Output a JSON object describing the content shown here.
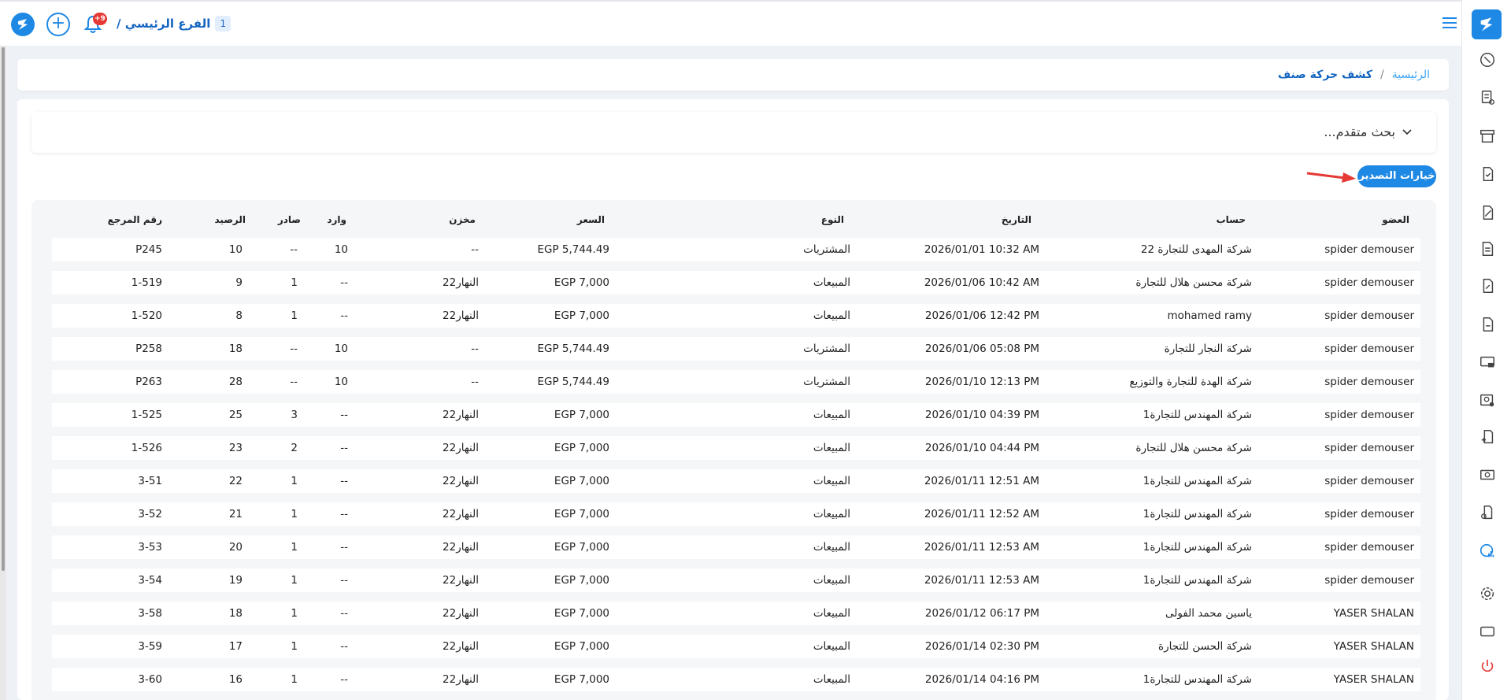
{
  "topbar": {
    "branch_label": "الفرع الرئيسي /",
    "branch_number": "1",
    "notification_count": "+9"
  },
  "breadcrumb": {
    "home": "الرئيسية",
    "separator": "/",
    "current": "كشف حركة صنف"
  },
  "advanced_search": {
    "label": "بحث متقدم..."
  },
  "export_button": {
    "label": "خيارات التصدير"
  },
  "table": {
    "headers": {
      "member": "العضو",
      "account": "حساب",
      "date": "التاريخ",
      "type": "النوع",
      "price": "السعر",
      "store": "مخزن",
      "incoming": "وارد",
      "outgoing": "صادر",
      "balance": "الرصيد",
      "ref": "رقم المرجع"
    },
    "rows": [
      {
        "member": "spider demouser",
        "account": "شركة المهدى للتجارة 22",
        "date": "2026/01/01 10:32 AM",
        "type": "المشتريات",
        "price": "EGP 5,744.49",
        "store": "--",
        "incoming": "10",
        "outgoing": "--",
        "balance": "10",
        "ref": "P245"
      },
      {
        "member": "spider demouser",
        "account": "شركة محسن هلال للتجارة",
        "date": "2026/01/06 10:42 AM",
        "type": "المبيعات",
        "price": "EGP 7,000",
        "store": "النهار22",
        "incoming": "--",
        "outgoing": "1",
        "balance": "9",
        "ref": "1-519"
      },
      {
        "member": "spider demouser",
        "account": "mohamed ramy",
        "date": "2026/01/06 12:42 PM",
        "type": "المبيعات",
        "price": "EGP 7,000",
        "store": "النهار22",
        "incoming": "--",
        "outgoing": "1",
        "balance": "8",
        "ref": "1-520"
      },
      {
        "member": "spider demouser",
        "account": "شركة النجار للتجارة",
        "date": "2026/01/06 05:08 PM",
        "type": "المشتريات",
        "price": "EGP 5,744.49",
        "store": "--",
        "incoming": "10",
        "outgoing": "--",
        "balance": "18",
        "ref": "P258"
      },
      {
        "member": "spider demouser",
        "account": "شركة الهدة للتجارة والتوزيع",
        "date": "2026/01/10 12:13 PM",
        "type": "المشتريات",
        "price": "EGP 5,744.49",
        "store": "--",
        "incoming": "10",
        "outgoing": "--",
        "balance": "28",
        "ref": "P263"
      },
      {
        "member": "spider demouser",
        "account": "شركة المهندس للتجارة1",
        "date": "2026/01/10 04:39 PM",
        "type": "المبيعات",
        "price": "EGP 7,000",
        "store": "النهار22",
        "incoming": "--",
        "outgoing": "3",
        "balance": "25",
        "ref": "1-525"
      },
      {
        "member": "spider demouser",
        "account": "شركة محسن هلال للتجارة",
        "date": "2026/01/10 04:44 PM",
        "type": "المبيعات",
        "price": "EGP 7,000",
        "store": "النهار22",
        "incoming": "--",
        "outgoing": "2",
        "balance": "23",
        "ref": "1-526"
      },
      {
        "member": "spider demouser",
        "account": "شركة المهندس للتجارة1",
        "date": "2026/01/11 12:51 AM",
        "type": "المبيعات",
        "price": "EGP 7,000",
        "store": "النهار22",
        "incoming": "--",
        "outgoing": "1",
        "balance": "22",
        "ref": "3-51"
      },
      {
        "member": "spider demouser",
        "account": "شركة المهندس للتجارة1",
        "date": "2026/01/11 12:52 AM",
        "type": "المبيعات",
        "price": "EGP 7,000",
        "store": "النهار22",
        "incoming": "--",
        "outgoing": "1",
        "balance": "21",
        "ref": "3-52"
      },
      {
        "member": "spider demouser",
        "account": "شركة المهندس للتجارة1",
        "date": "2026/01/11 12:53 AM",
        "type": "المبيعات",
        "price": "EGP 7,000",
        "store": "النهار22",
        "incoming": "--",
        "outgoing": "1",
        "balance": "20",
        "ref": "3-53"
      },
      {
        "member": "spider demouser",
        "account": "شركة المهندس للتجارة1",
        "date": "2026/01/11 12:53 AM",
        "type": "المبيعات",
        "price": "EGP 7,000",
        "store": "النهار22",
        "incoming": "--",
        "outgoing": "1",
        "balance": "19",
        "ref": "3-54"
      },
      {
        "member": "YASER SHALAN",
        "account": "ياسين محمد الفولى",
        "date": "2026/01/12 06:17 PM",
        "type": "المبيعات",
        "price": "EGP 7,000",
        "store": "النهار22",
        "incoming": "--",
        "outgoing": "1",
        "balance": "18",
        "ref": "3-58"
      },
      {
        "member": "YASER SHALAN",
        "account": "شركة الحسن للتجارة",
        "date": "2026/01/14 02:30 PM",
        "type": "المبيعات",
        "price": "EGP 7,000",
        "store": "النهار22",
        "incoming": "--",
        "outgoing": "1",
        "balance": "17",
        "ref": "3-59"
      },
      {
        "member": "YASER SHALAN",
        "account": "شركة المهندس للتجارة1",
        "date": "2026/01/14 04:16 PM",
        "type": "المبيعات",
        "price": "EGP 7,000",
        "store": "النهار22",
        "incoming": "--",
        "outgoing": "1",
        "balance": "16",
        "ref": "3-60"
      }
    ]
  },
  "sidebar": {
    "icons": [
      "dashboard-icon",
      "invoice-icon",
      "store-icon",
      "purchase-icon",
      "sales-icon",
      "document-icon",
      "returns-icon",
      "return-invoice-icon",
      "pos-icon",
      "employee-icon",
      "add-customer-icon",
      "money-icon",
      "expense-icon",
      "reports-icon",
      "settings-icon",
      "window-icon",
      "power-icon"
    ],
    "active": "reports-icon",
    "accent": "#1e88e5",
    "danger": "#e53935"
  }
}
